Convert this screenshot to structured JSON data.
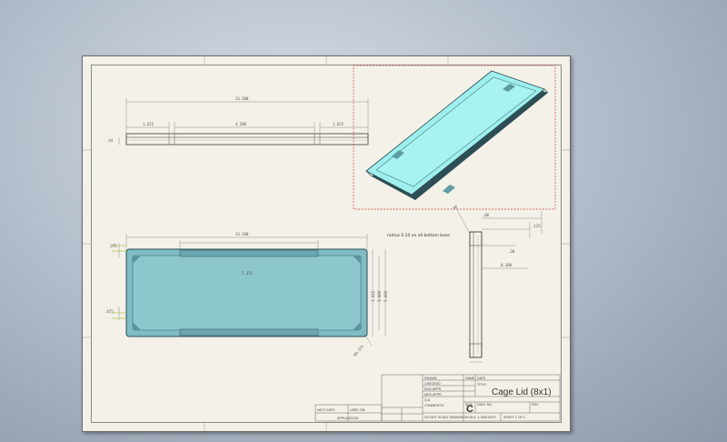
{
  "app": "SolidWorks drawing viewport",
  "drawing": {
    "top_view_dims": {
      "overall": "13.500",
      "left": "1.625",
      "center": "4.500",
      "right": "1.625",
      "height": ".44"
    },
    "plan_view_dims": {
      "overall": "13.500",
      "inner": "7.375",
      "left_h": ".375",
      "left_h2": ".875",
      "side_a": "1.312",
      "side_b": "3.000",
      "side_c": "5.000",
      "corner": "R0.375"
    },
    "side_view_note": "radius 0.10 on all bottom base",
    "side_view_dims": {
      "a": ".06",
      "b": ".125",
      "c": ".30",
      "d": ".50",
      "e": "0.100"
    },
    "title_block": {
      "title": "Cage Lid (8x1)",
      "size": "C",
      "size_label": "SIZE",
      "dwg_no_label": "DWG. NO.",
      "rev_label": "REV",
      "scale_label": "SCALE: 1:4",
      "weight_label": "WEIGHT:",
      "sheet_label": "SHEET 1 OF 1",
      "title_label": "TITLE:",
      "name_label": "NAME",
      "date_label": "DATE",
      "drawn_label": "DRAWN",
      "checked_label": "CHECKED",
      "eng_label": "ENG APPR.",
      "mfg_label": "MFG APPR.",
      "qa_label": "Q.A.",
      "comments_label": "COMMENTS:",
      "next_assy": "NEXT ASSY",
      "used_on": "USED ON",
      "application": "APPLICATION",
      "do_not_scale": "DO NOT SCALE DRAWING"
    },
    "colors": {
      "sheet": "#f3f1e8",
      "iso_fill": "#9ef0ee",
      "plan_fill": "#7fbcc4",
      "model_edge": "#2e4e55",
      "selection_box": "#d04040"
    }
  }
}
